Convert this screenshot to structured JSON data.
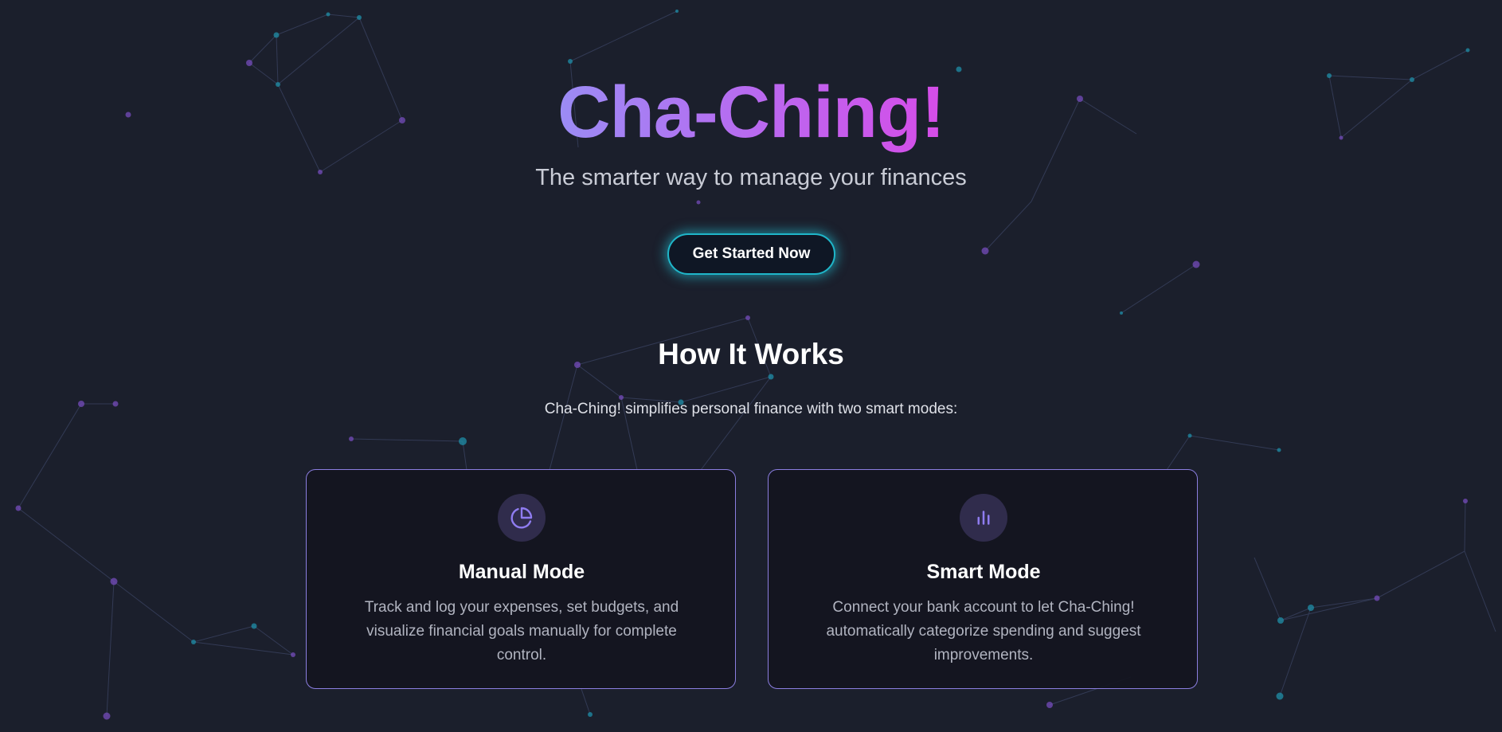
{
  "hero": {
    "title": "Cha-Ching!",
    "subtitle": "The smarter way to manage your finances",
    "cta_label": "Get Started Now"
  },
  "how_it_works": {
    "title": "How It Works",
    "description": "Cha-Ching! simplifies personal finance with two smart modes:"
  },
  "cards": [
    {
      "icon": "pie-chart-icon",
      "title": "Manual Mode",
      "text": "Track and log your expenses, set budgets, and visualize financial goals manually for complete control."
    },
    {
      "icon": "bar-chart-icon",
      "title": "Smart Mode",
      "text": "Connect your bank account to let Cha-Ching! automatically categorize spending and suggest improvements."
    }
  ],
  "colors": {
    "background": "#1b1f2c",
    "title_gradient_start": "#9b8cf5",
    "title_gradient_end": "#d64ce8",
    "cta_glow": "#1fb6c9",
    "card_border": "#8b7ee0",
    "icon_accent": "#8f7cf0"
  }
}
